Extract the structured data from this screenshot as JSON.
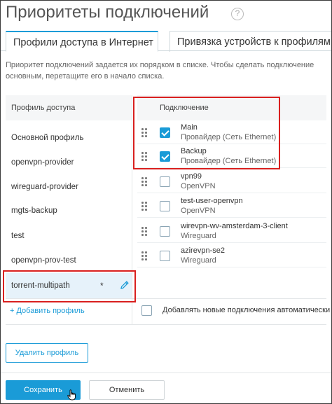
{
  "page_title": "Приоритеты подключений",
  "help_icon": "?",
  "tabs": [
    {
      "label": "Профили доступа в Интернет",
      "active": true
    },
    {
      "label": "Привязка устройств к профилям",
      "active": false
    }
  ],
  "hint": "Приоритет подключений задается их порядком в списке. Чтобы сделать подключение основным, перетащите его в начало списка.",
  "columns": {
    "profile": "Профиль доступа",
    "connection": "Подключение"
  },
  "profiles": [
    {
      "label": "Основной профиль"
    },
    {
      "label": "openvpn-provider"
    },
    {
      "label": "wireguard-provider"
    },
    {
      "label": "mgts-backup"
    },
    {
      "label": "test"
    },
    {
      "label": "openvpn-prov-test"
    },
    {
      "label": "torrent-multipath",
      "marker": "*"
    }
  ],
  "connections": [
    {
      "name": "Main",
      "sub": "Провайдер (Сеть Ethernet)",
      "checked": true
    },
    {
      "name": "Backup",
      "sub": "Провайдер (Сеть Ethernet)",
      "checked": true
    },
    {
      "name": "vpn99",
      "sub": "OpenVPN",
      "checked": false
    },
    {
      "name": "test-user-openvpn",
      "sub": "OpenVPN",
      "checked": false
    },
    {
      "name": "wirevpn-wv-amsterdam-3-client",
      "sub": "Wireguard",
      "checked": false
    },
    {
      "name": "azirevpn-se2",
      "sub": "Wireguard",
      "checked": false
    }
  ],
  "add_profile": "+ Добавить профиль",
  "auto_add_label": "Добавлять новые подключения автоматически",
  "buttons": {
    "delete_profile": "Удалить профиль",
    "save": "Сохранить",
    "cancel": "Отменить"
  },
  "colors": {
    "accent": "#1a9bd7",
    "highlight": "#d9201f",
    "selected_row": "#e6f2fa"
  }
}
